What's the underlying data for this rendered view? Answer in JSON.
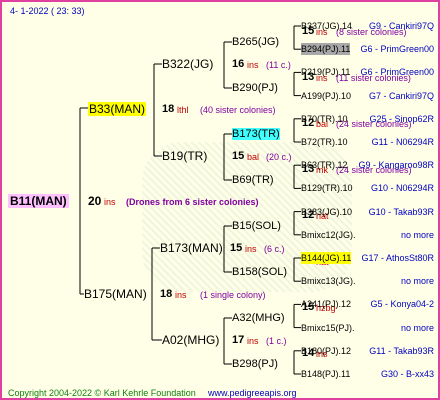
{
  "header": "4-   1-2022  ( 23:  33)",
  "footer": {
    "copyright": "Copyright 2004-2022 © Karl Kehrle Foundation",
    "site": "www.pedigreeapis.org"
  },
  "root": {
    "name": "B11(MAN)",
    "num": "20",
    "ins": "ins",
    "note": "(Drones from 6 sister colonies)"
  },
  "gen1": [
    {
      "name": "B33(MAN)",
      "num": "18",
      "ins": "lthl",
      "note": "(40 sister colonies)"
    },
    {
      "name": "B175(MAN)",
      "num": "18",
      "ins": "ins",
      "note": "(1 single colony)"
    }
  ],
  "gen2": [
    {
      "name": "B322(JG)",
      "num": "16",
      "ins": "ins",
      "note": "(11 c.)"
    },
    {
      "name": "B19(TR)",
      "num": "15",
      "ins": "bal",
      "note": "(20 c.)"
    },
    {
      "name": "B173(MAN)",
      "num": "15",
      "ins": "ins",
      "note": "(6 c.)"
    },
    {
      "name": "A02(MHG)",
      "num": "17",
      "ins": "ins",
      "note": "(1 c.)"
    }
  ],
  "gen3": [
    {
      "name": "B265(JG)",
      "num": "15",
      "ins": "ins",
      "note": "(8 sister colonies)"
    },
    {
      "name": "B290(PJ)",
      "num": "13",
      "ins": "ins",
      "note": "(11 sister colonies)"
    },
    {
      "name": "B173(TR)",
      "num": "12",
      "ins": "bal",
      "note": "(24 sister colonies)"
    },
    {
      "name": "B69(TR)",
      "num": "13",
      "ins": "mk",
      "note": "(24 sister colonies)"
    },
    {
      "name": "B15(SOL)",
      "num": "12",
      "ins": "nat",
      "note": ""
    },
    {
      "name": "B158(SOL)",
      "num": "13",
      "ins": "nat",
      "note": ""
    },
    {
      "name": "A32(MHG)",
      "num": "15",
      "ins": "hzbg",
      "note": ""
    },
    {
      "name": "B298(PJ)",
      "num": "14",
      "ins": "ins",
      "note": ""
    }
  ],
  "gen4": [
    {
      "name": "B337(JG).14",
      "tag": "G9 - Cankiri97Q"
    },
    {
      "name": "B294(PJ).11",
      "tag": "G6 - PrimGreen00"
    },
    {
      "name": "P219(PJ).11",
      "tag": "G6 - PrimGreen00"
    },
    {
      "name": "A199(PJ).10",
      "tag": "G7 - Cankiri97Q"
    },
    {
      "name": "B70(TR).10",
      "tag": "G25 - Sinop62R"
    },
    {
      "name": "B72(TR).10",
      "tag": "G11 - N06294R"
    },
    {
      "name": "B63(TR).12",
      "tag": "G9 - Kangaroo98R"
    },
    {
      "name": "B129(TR).10",
      "tag": "G10 - N06294R"
    },
    {
      "name": "B383(JG).10",
      "tag": "G10 - Takab93R"
    },
    {
      "name": "Bmixc12(JG).",
      "tag": "no more"
    },
    {
      "name": "B144(JG).11",
      "tag": "G17 - AthosSt80R"
    },
    {
      "name": "Bmixc13(JG).",
      "tag": "no more"
    },
    {
      "name": "A241(PJ).12",
      "tag": "G5 - Konya04-2"
    },
    {
      "name": "Bmixc15(PJ).",
      "tag": "no more"
    },
    {
      "name": "B180(PJ).12",
      "tag": "G11 - Takab93R"
    },
    {
      "name": "B148(PJ).11",
      "tag": "G30 - B-xx43"
    }
  ]
}
